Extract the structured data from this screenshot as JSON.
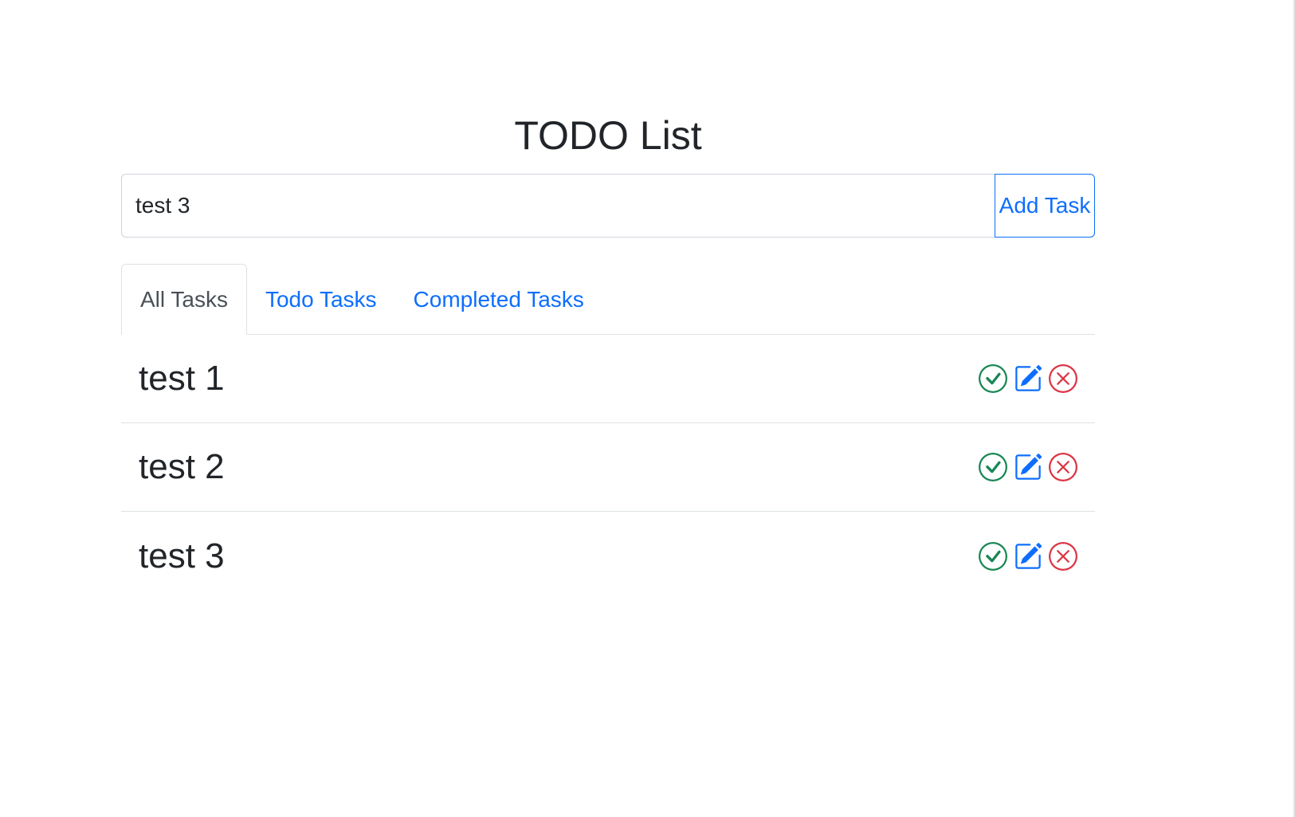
{
  "header": {
    "title": "TODO List"
  },
  "new_task": {
    "value": "test 3",
    "add_label": "Add Task"
  },
  "tabs": [
    {
      "label": "All Tasks",
      "active": true
    },
    {
      "label": "Todo Tasks",
      "active": false
    },
    {
      "label": "Completed Tasks",
      "active": false
    }
  ],
  "tasks": [
    {
      "name": "test 1"
    },
    {
      "name": "test 2"
    },
    {
      "name": "test 3"
    }
  ],
  "icons": {
    "complete": "check-circle-icon",
    "edit": "pencil-square-icon",
    "delete": "x-circle-icon"
  },
  "colors": {
    "primary": "#0d6efd",
    "success": "#198754",
    "danger": "#dc3545",
    "text": "#212529",
    "border": "#dee2e6"
  }
}
